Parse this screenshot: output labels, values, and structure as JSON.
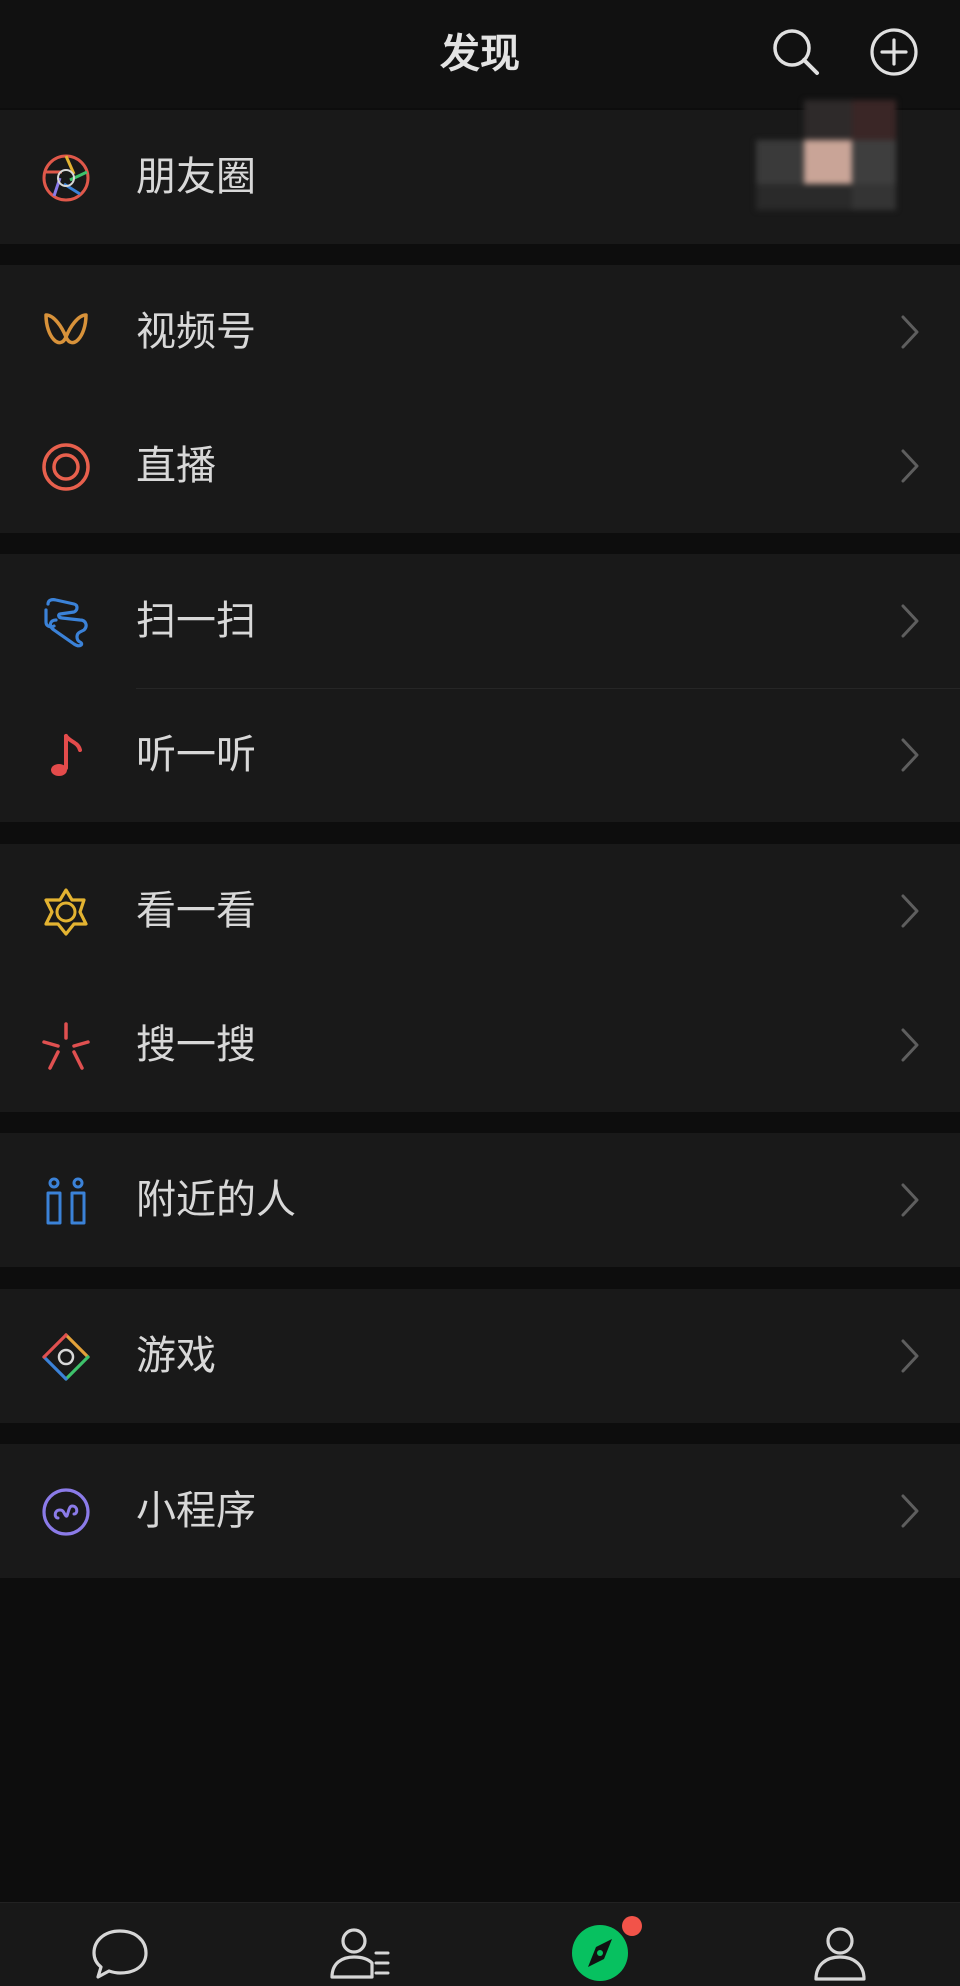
{
  "header": {
    "title": "发现",
    "search_icon": "search-icon",
    "add_icon": "plus-circle-icon"
  },
  "groups": [
    {
      "items": [
        {
          "label": "朋友圈",
          "icon": "moments-aperture-icon",
          "color": "#e0584a"
        }
      ]
    },
    {
      "items": [
        {
          "label": "视频号",
          "icon": "channels-butterfly-icon",
          "color": "#d8923a"
        },
        {
          "label": "直播",
          "icon": "live-circle-icon",
          "color": "#e8604d"
        }
      ]
    },
    {
      "items": [
        {
          "label": "扫一扫",
          "icon": "scan-icon",
          "color": "#3b82d8"
        },
        {
          "label": "听一听",
          "icon": "music-note-icon",
          "color": "#e34b4b"
        }
      ]
    },
    {
      "items": [
        {
          "label": "看一看",
          "icon": "top-stories-icon",
          "color": "#e3b331"
        },
        {
          "label": "搜一搜",
          "icon": "search-spark-icon",
          "color": "#e05050"
        }
      ]
    },
    {
      "items": [
        {
          "label": "附近的人",
          "icon": "people-nearby-icon",
          "color": "#3b82d8"
        }
      ]
    },
    {
      "items": [
        {
          "label": "游戏",
          "icon": "games-diamond-icon",
          "color": "#e3a23a"
        }
      ]
    },
    {
      "items": [
        {
          "label": "小程序",
          "icon": "mini-program-icon",
          "color": "#8b7be8"
        }
      ]
    }
  ],
  "tabbar": {
    "tabs": [
      {
        "icon": "chat-bubble-icon",
        "active": false
      },
      {
        "icon": "contacts-icon",
        "active": false
      },
      {
        "icon": "discover-compass-icon",
        "active": true,
        "badge": "dot"
      },
      {
        "icon": "me-person-icon",
        "active": false
      }
    ],
    "active_color": "#07c160",
    "badge_color": "#f25349"
  }
}
